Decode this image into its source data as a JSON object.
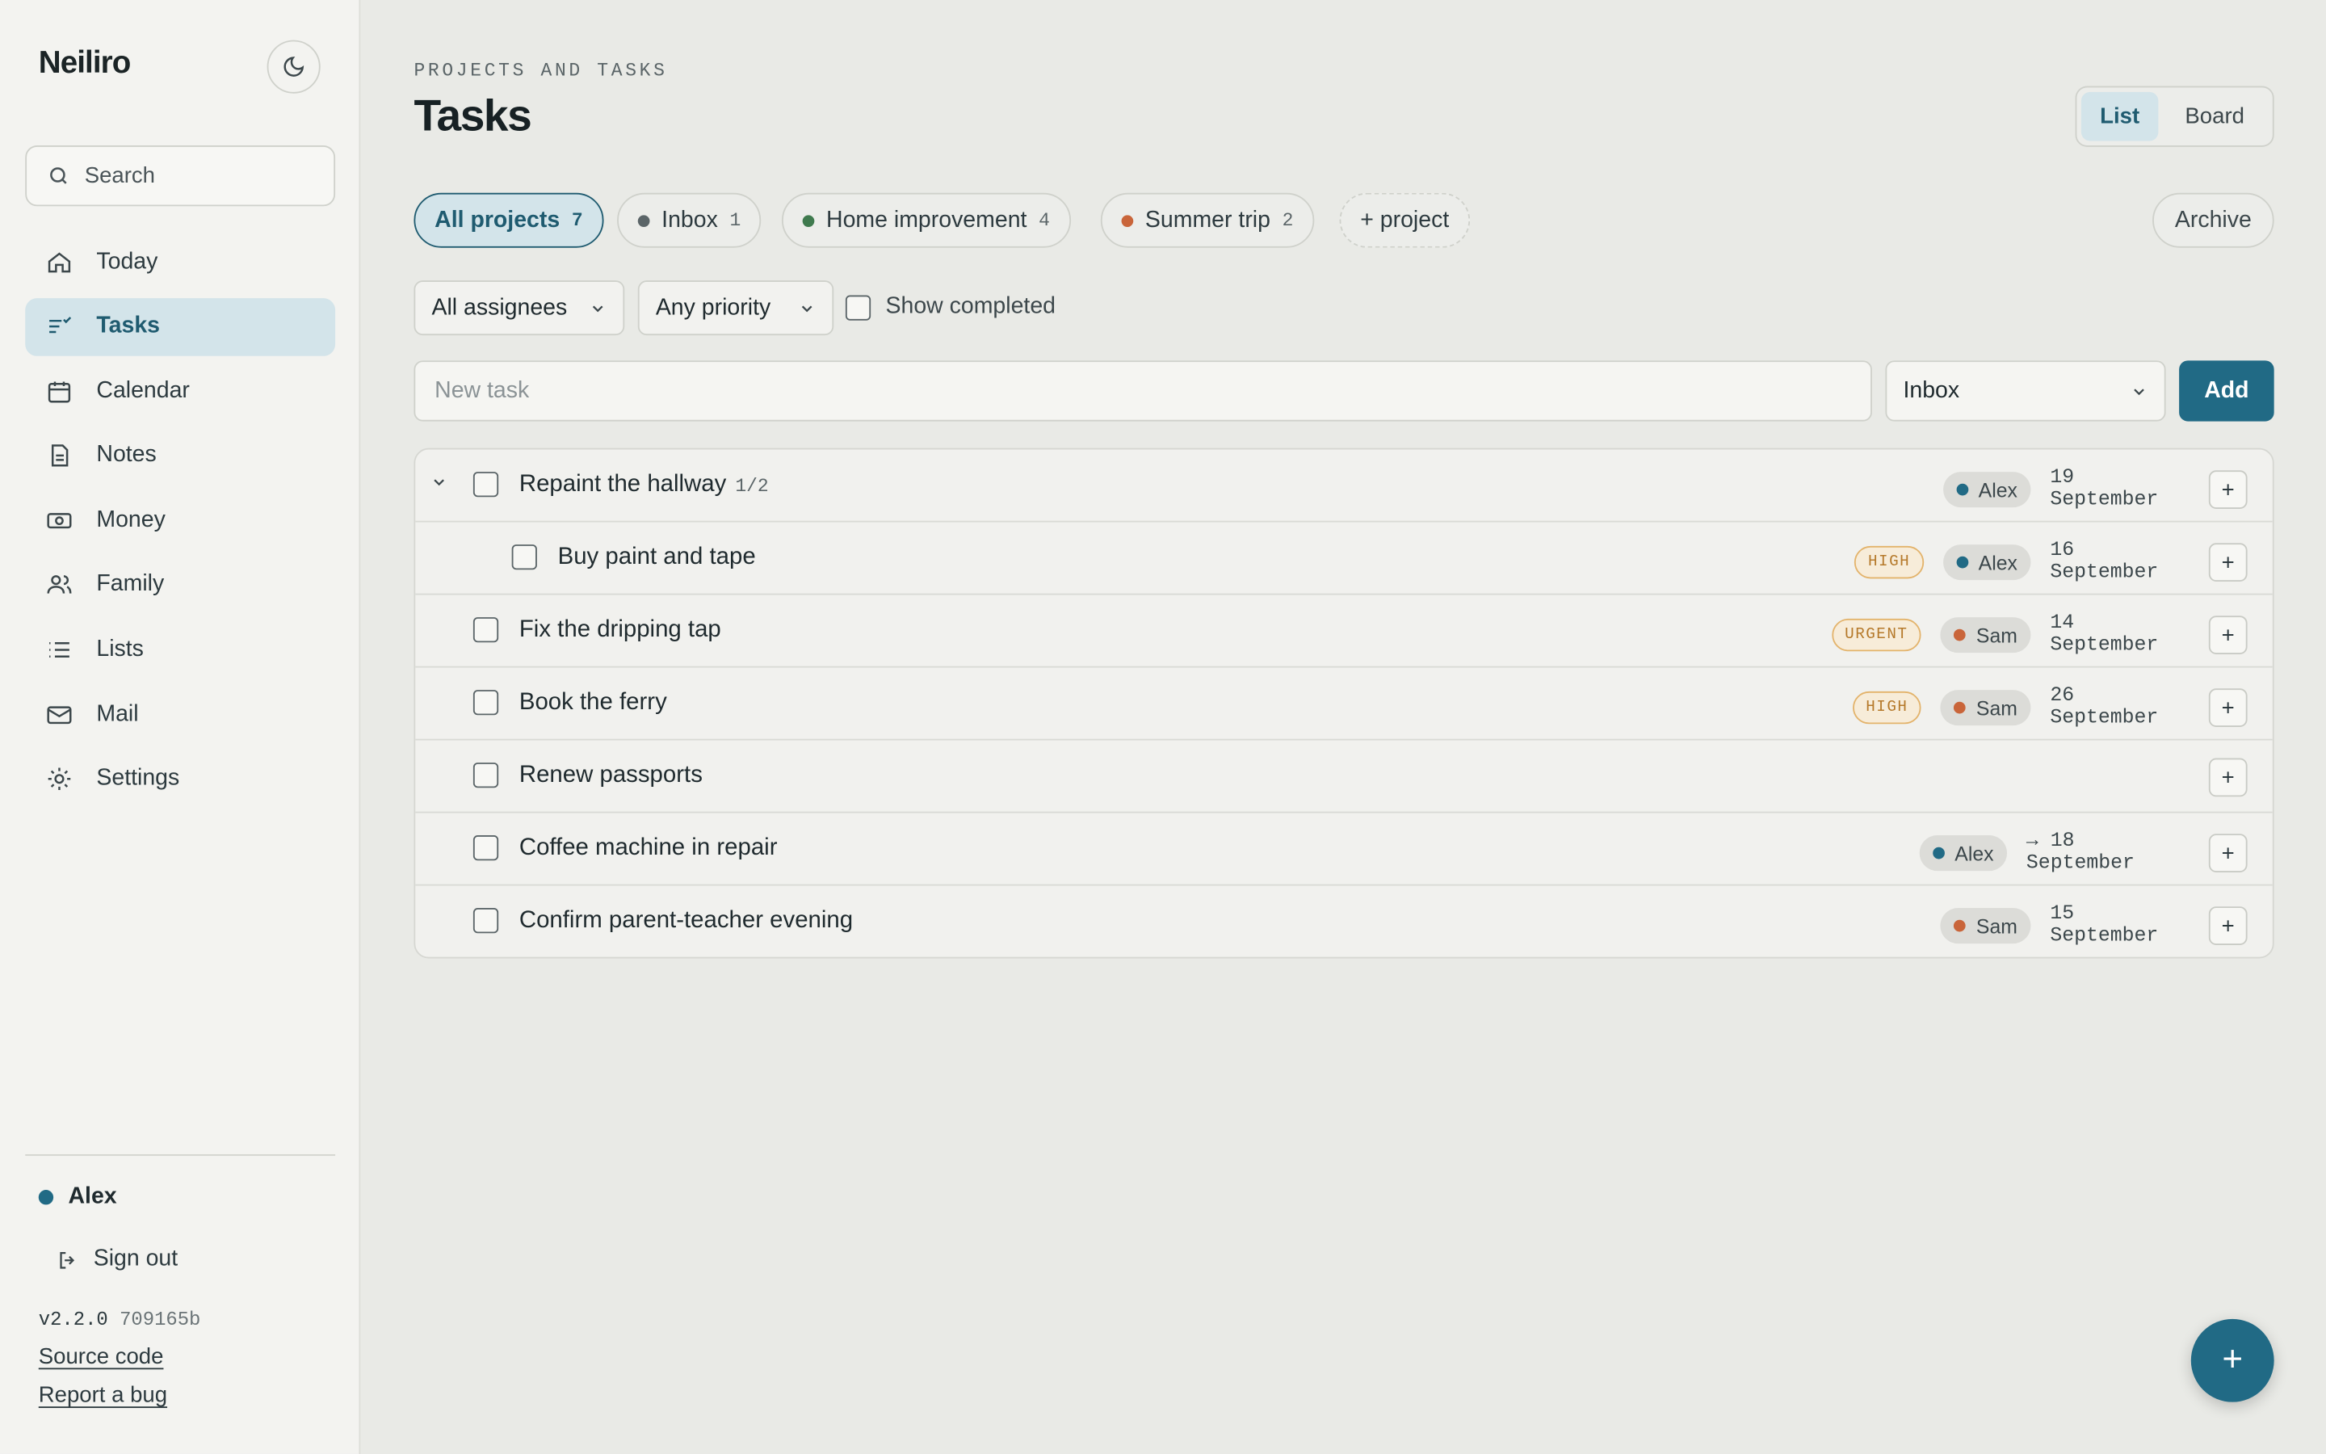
{
  "app": {
    "name": "Neiliro"
  },
  "sidebar": {
    "search_placeholder": "Search",
    "items": [
      {
        "label": "Today",
        "icon": "home-icon"
      },
      {
        "label": "Tasks",
        "icon": "tasks-icon",
        "active": true
      },
      {
        "label": "Calendar",
        "icon": "calendar-icon"
      },
      {
        "label": "Notes",
        "icon": "note-icon"
      },
      {
        "label": "Money",
        "icon": "money-icon"
      },
      {
        "label": "Family",
        "icon": "family-icon"
      },
      {
        "label": "Lists",
        "icon": "list-icon"
      },
      {
        "label": "Mail",
        "icon": "mail-icon"
      },
      {
        "label": "Settings",
        "icon": "gear-icon"
      }
    ],
    "user": {
      "name": "Alex",
      "color": "#216a85"
    },
    "sign_out": "Sign out",
    "version": "v2.2.0",
    "commit": "709165b",
    "source_code": "Source code",
    "report_bug": "Report a bug"
  },
  "header": {
    "eyebrow": "PROJECTS AND TASKS",
    "title": "Tasks"
  },
  "view_toggle": {
    "list": "List",
    "board": "Board",
    "active": "List"
  },
  "projects": [
    {
      "label": "All projects",
      "count": "7",
      "active": true
    },
    {
      "label": "Inbox",
      "count": "1",
      "color": "#5b6568"
    },
    {
      "label": "Home improvement",
      "count": "4",
      "color": "#3f7a4e"
    },
    {
      "label": "Summer trip",
      "count": "2",
      "color": "#c9653a"
    }
  ],
  "add_project": "+ project",
  "archive": "Archive",
  "filters": {
    "assignees": "All assignees",
    "priority": "Any priority",
    "show_completed": "Show completed"
  },
  "new_task": {
    "placeholder": "New task",
    "project": "Inbox",
    "add": "Add"
  },
  "tasks": [
    {
      "title": "Repaint the hallway",
      "progress": "1/2",
      "assignee": "Alex",
      "assignee_color": "#216a85",
      "date": "19 September"
    },
    {
      "title": "Buy paint and tape",
      "priority": "HIGH",
      "assignee": "Alex",
      "assignee_color": "#216a85",
      "date": "16 September"
    },
    {
      "title": "Fix the dripping tap",
      "priority": "URGENT",
      "assignee": "Sam",
      "assignee_color": "#c9653a",
      "date": "14 September"
    },
    {
      "title": "Book the ferry",
      "priority": "HIGH",
      "assignee": "Sam",
      "assignee_color": "#c9653a",
      "date": "26 September"
    },
    {
      "title": "Renew passports"
    },
    {
      "title": "Coffee machine in repair",
      "assignee": "Alex",
      "assignee_color": "#216a85",
      "date": "→ 18 September"
    },
    {
      "title": "Confirm parent-teacher evening",
      "assignee": "Sam",
      "assignee_color": "#c9653a",
      "date": "15 September"
    }
  ],
  "fab": "+",
  "colors": {
    "accent": "#216a85",
    "active_bg": "#d3e4ea",
    "urgent": "#b5792a"
  }
}
